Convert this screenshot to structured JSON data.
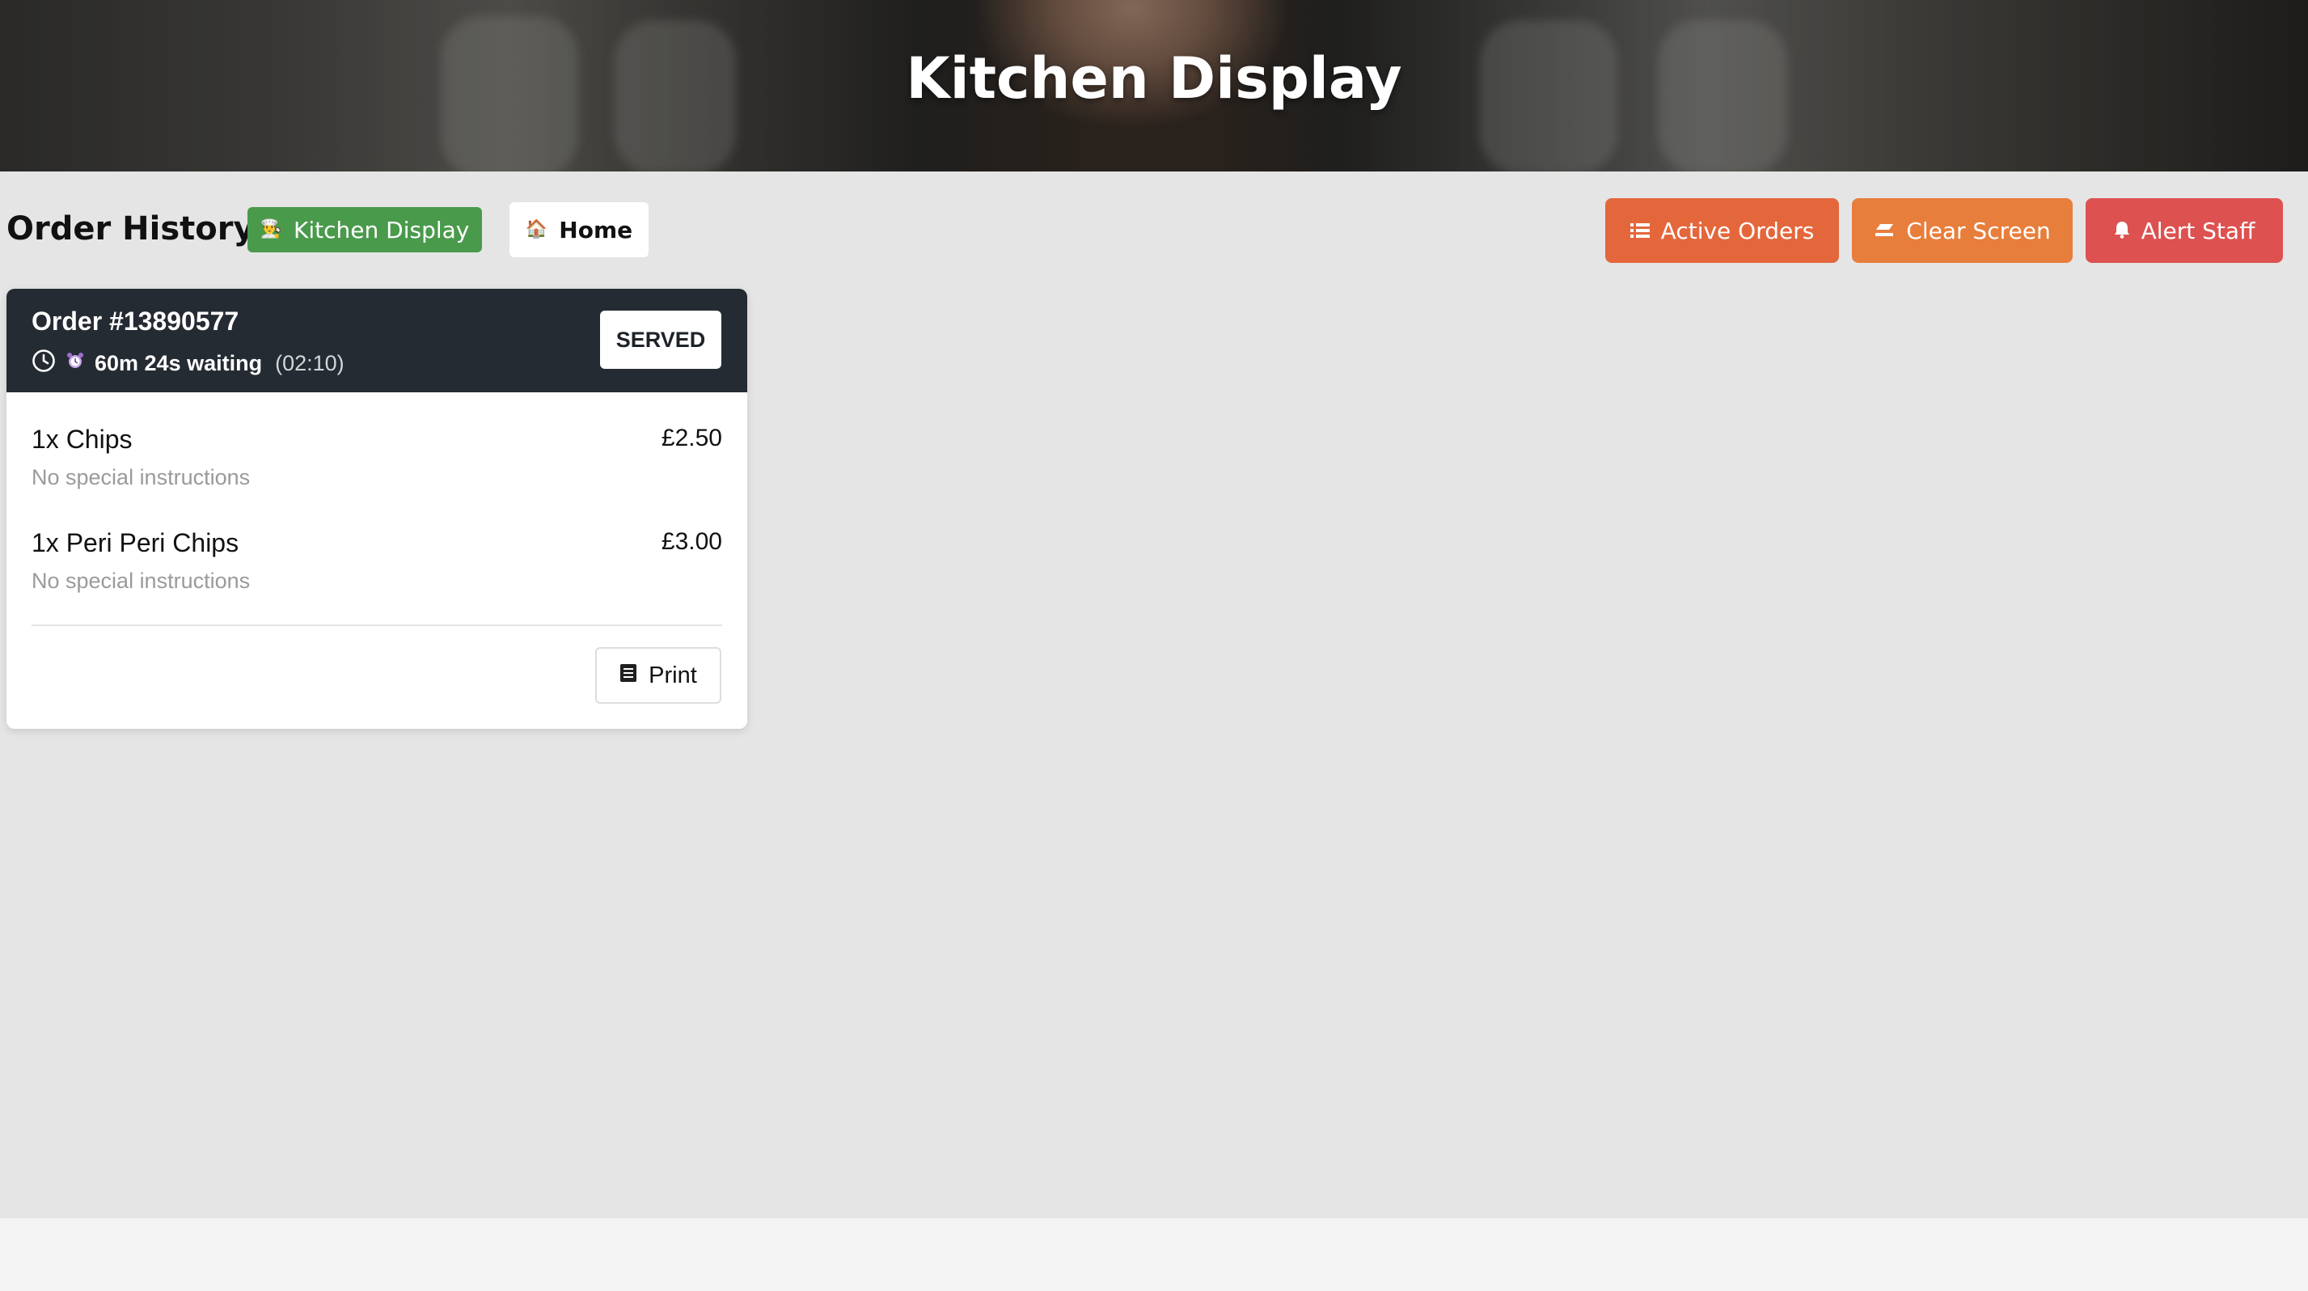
{
  "hero": {
    "title": "Kitchen Display"
  },
  "toolbar": {
    "section_title": "Order History",
    "kitchen_display_label": "Kitchen Display",
    "kitchen_display_icon": "cook-icon",
    "home_label": "Home",
    "home_icon": "house-icon",
    "active_orders_label": "Active Orders",
    "active_orders_icon": "list-icon",
    "clear_screen_label": "Clear Screen",
    "clear_screen_icon": "eraser-icon",
    "alert_staff_label": "Alert Staff",
    "alert_staff_icon": "bell-icon"
  },
  "orders": [
    {
      "number": "Order #13890577",
      "waiting": "60m 24s waiting",
      "time": "(02:10)",
      "status": "SERVED",
      "items": [
        {
          "name": "1x Chips",
          "price": "£2.50",
          "note": "No special instructions"
        },
        {
          "name": "1x Peri Peri Chips",
          "price": "£3.00",
          "note": "No special instructions"
        }
      ],
      "print_label": "Print"
    }
  ],
  "colors": {
    "kitchen_display": "#4a9a4c",
    "active_orders": "#e4673c",
    "clear_screen": "#e87e3b",
    "alert_staff": "#dd5150",
    "card_header": "#252b33",
    "page_background": "#e5e5e5"
  }
}
